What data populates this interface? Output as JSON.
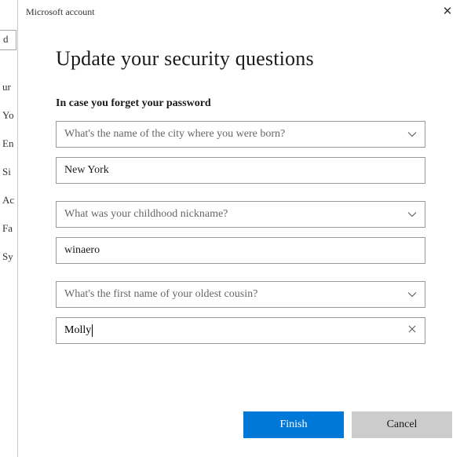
{
  "dialog": {
    "title": "Microsoft account",
    "close_glyph": "✕"
  },
  "page": {
    "heading": "Update your security questions",
    "subhead": "In case you forget your password"
  },
  "questions": [
    {
      "question": "What's the name of the city where you were born?",
      "answer": "New York"
    },
    {
      "question": "What was your childhood nickname?",
      "answer": "winaero"
    },
    {
      "question": "What's the first name of your oldest cousin?",
      "answer": "Molly"
    }
  ],
  "footer": {
    "primary": "Finish",
    "secondary": "Cancel"
  },
  "bg": {
    "box": "d",
    "items": [
      "ur",
      "Yo",
      "En",
      "Si",
      "Ac",
      "Fa",
      "Sy"
    ]
  }
}
